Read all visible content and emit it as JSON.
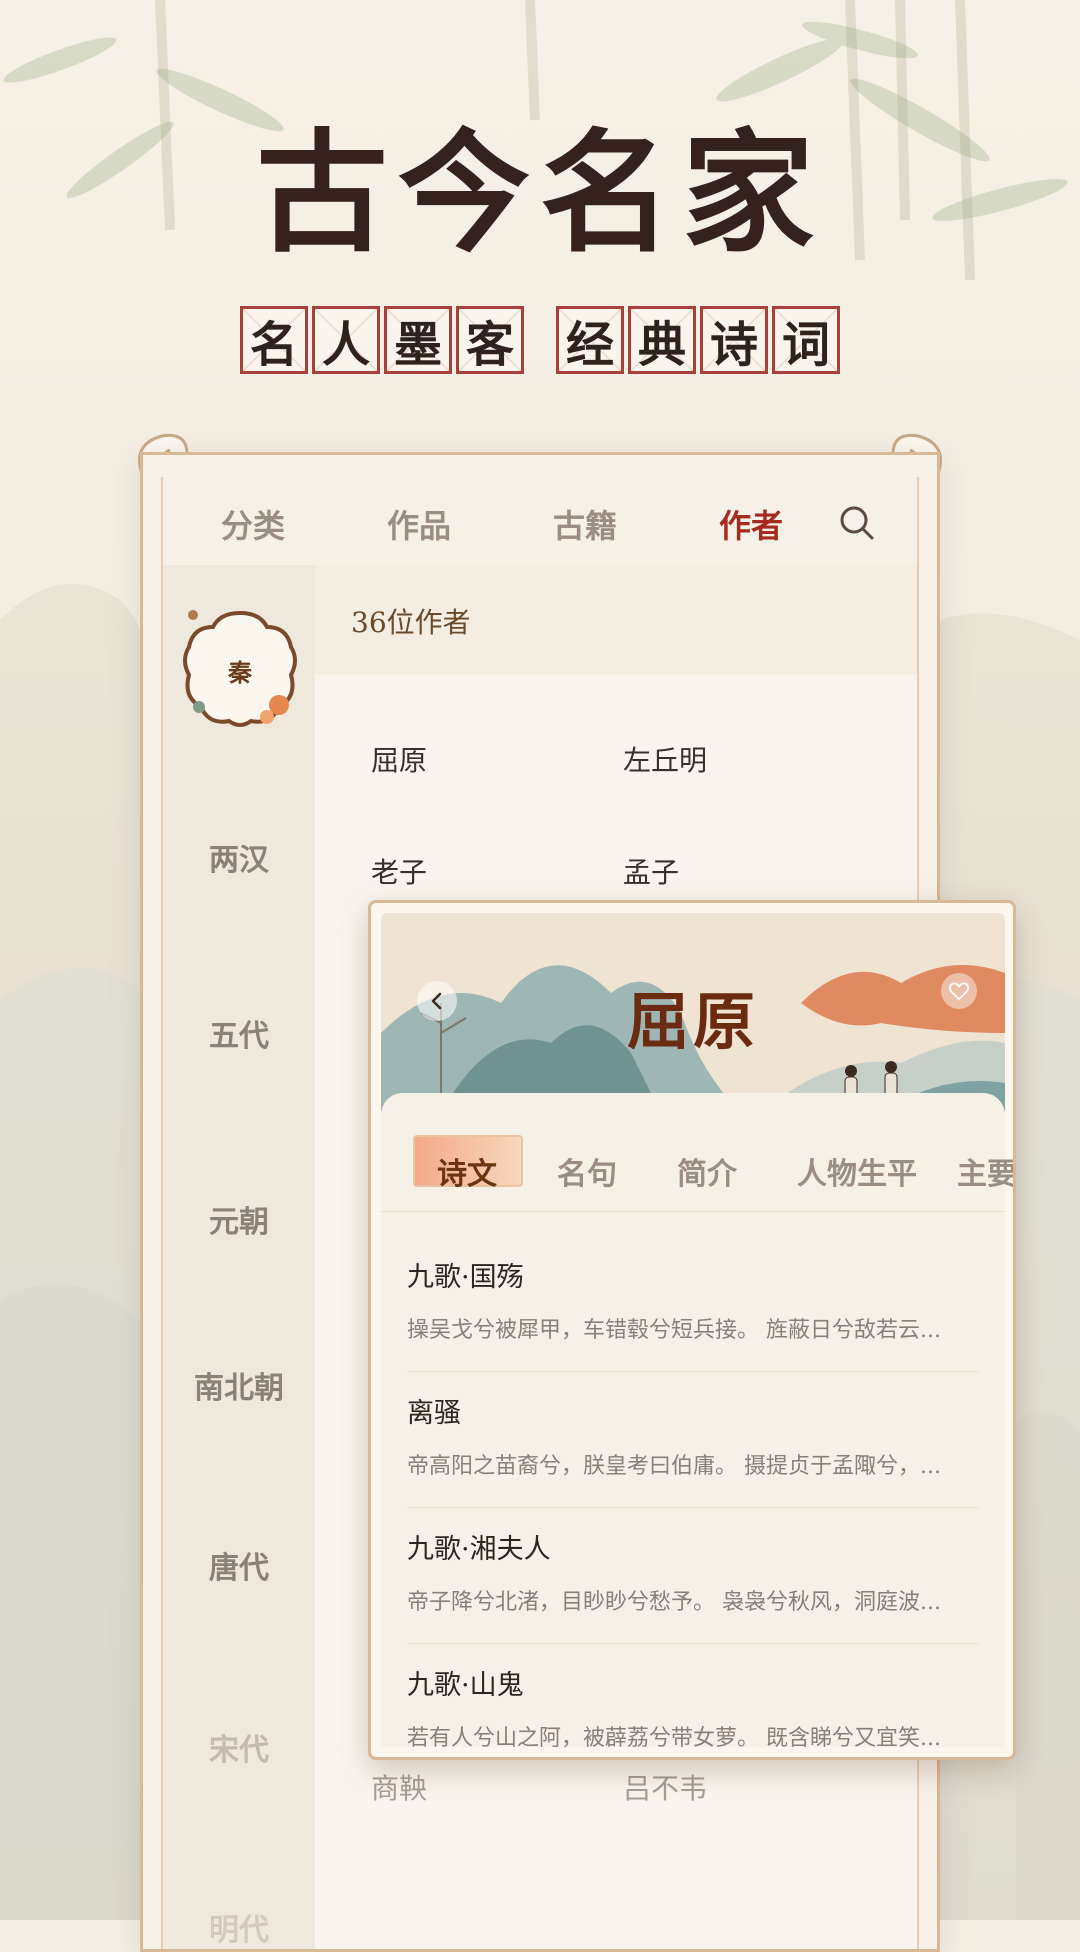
{
  "headline": "古今名家",
  "tagline": {
    "left": [
      "名",
      "人",
      "墨",
      "客"
    ],
    "right": [
      "经",
      "典",
      "诗",
      "词"
    ]
  },
  "tabs": {
    "items": [
      "分类",
      "作品",
      "古籍",
      "作者"
    ],
    "active": "作者"
  },
  "sidebar": {
    "selected": "秦",
    "dynasties": [
      "两汉",
      "五代",
      "元朝",
      "南北朝",
      "唐代",
      "宋代",
      "明代"
    ]
  },
  "content": {
    "count_label": "36位作者",
    "authors": [
      "屈原",
      "左丘明",
      "老子",
      "孟子"
    ],
    "authors_bottom": [
      "商鞅",
      "吕不韦"
    ]
  },
  "card": {
    "title": "屈原",
    "tabs": [
      "诗文",
      "名句",
      "简介",
      "人物生平",
      "主要"
    ],
    "active_tab": "诗文",
    "poems": [
      {
        "title": "九歌·国殇",
        "excerpt": "操吴戈兮被犀甲，车错毂兮短兵接。 旌蔽日兮敌若云..."
      },
      {
        "title": "离骚",
        "excerpt": "帝高阳之苗裔兮，朕皇考曰伯庸。 摄提贞于孟陬兮，..."
      },
      {
        "title": "九歌·湘夫人",
        "excerpt": "帝子降兮北渚，目眇眇兮愁予。 袅袅兮秋风，洞庭波..."
      },
      {
        "title": "九歌·山鬼",
        "excerpt": "若有人兮山之阿，被薜荔兮带女萝。 既含睇兮又宜笑..."
      }
    ]
  },
  "colors": {
    "accent": "#a52a20",
    "tile_border": "#a8403b",
    "panel_border": "#d9b895"
  },
  "icons": [
    "search-icon",
    "back-arrow-icon",
    "heart-icon",
    "seal-frame-icon"
  ]
}
